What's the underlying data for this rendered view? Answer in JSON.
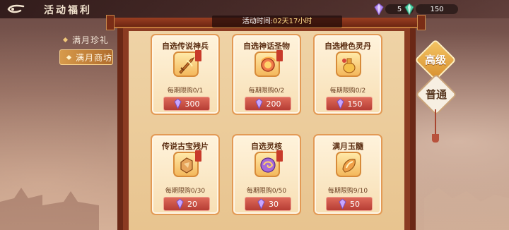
{
  "header": {
    "title": "活动福利"
  },
  "currencies": [
    {
      "icon": "purple-gem-icon",
      "value": "5",
      "color": "#b48cf0"
    },
    {
      "icon": "green-gem-icon",
      "value": "150",
      "color": "#53d3a8"
    }
  ],
  "tabs": [
    {
      "label": "满月珍礼",
      "active": false
    },
    {
      "label": "满月商坊",
      "active": true
    }
  ],
  "timer": {
    "label": "活动时间:",
    "value": "02天17小时"
  },
  "tiers": {
    "premium": "高级",
    "normal": "普通"
  },
  "cards": [
    {
      "name": "自选传说神兵",
      "icon": "sword-icon",
      "limit": "每期限购0/1",
      "price": "300"
    },
    {
      "name": "自选神话圣物",
      "icon": "relic-orb-icon",
      "limit": "每期限购0/2",
      "price": "200"
    },
    {
      "name": "自选橙色灵丹",
      "icon": "elixir-bottle-icon",
      "limit": "每期限购0/2",
      "price": "150"
    },
    {
      "name": "传说古宝残片",
      "icon": "treasure-fragment-icon",
      "limit": "每期限购0/30",
      "price": "20"
    },
    {
      "name": "自选灵核",
      "icon": "spirit-core-icon",
      "limit": "每期限购0/50",
      "price": "30"
    },
    {
      "name": "满月玉髓",
      "icon": "jade-marrow-icon",
      "limit": "每期限购9/10",
      "price": "50"
    }
  ]
}
